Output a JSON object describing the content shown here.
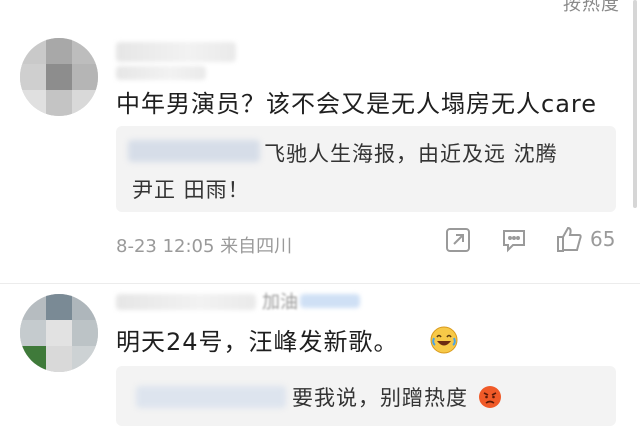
{
  "header": {
    "sort_label": "按热度"
  },
  "comments": [
    {
      "text": "中年男演员？该不会又是无人塌房无人care",
      "reply_preview": {
        "author_label": "影视综报：",
        "line1": "飞驰人生海报，由近及远  沈腾",
        "line2": "尹正  田雨！"
      },
      "meta": "8-23 12:05  来自四川",
      "likes": "65",
      "icons": [
        "share-icon",
        "comment-icon",
        "like-icon"
      ]
    },
    {
      "author_label": "加油",
      "text": "明天24号，汪峰发新歌。",
      "emoji": "laughing-tears-emoji",
      "reply_preview": {
        "line1": "要我说，别蹭热度"
      },
      "reply_emoji": "angry-face-emoji"
    }
  ]
}
